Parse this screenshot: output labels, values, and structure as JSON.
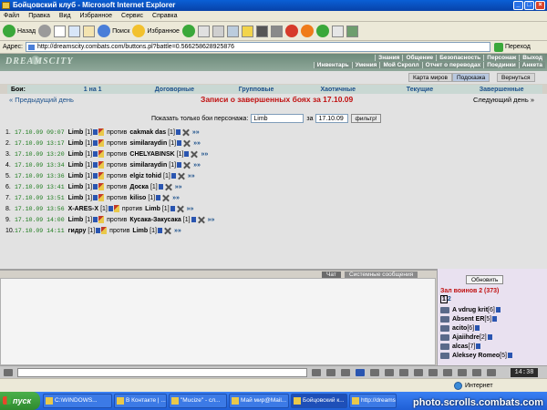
{
  "window": {
    "title": "Бойцовский клуб - Microsoft Internet Explorer"
  },
  "menu": [
    "Файл",
    "Правка",
    "Вид",
    "Избранное",
    "Сервис",
    "Справка"
  ],
  "toolbar": {
    "back": "Назад",
    "search": "Поиск",
    "favorites": "Избранное"
  },
  "address": {
    "label": "Адрес:",
    "url": "http://dreamscity.combats.com/buttons.pl?battle=0.566258628925876",
    "go": "Переход"
  },
  "site": {
    "logo": "DREAMSCITY",
    "nav_top": [
      "Знания",
      "Общение",
      "Безопасность",
      "Персонаж",
      "Выход"
    ],
    "nav_bottom": [
      "Инвентарь",
      "Умения",
      "Мой Скролл",
      "Отчет о переводах",
      "Поединки",
      "Анкета"
    ]
  },
  "tabs": [
    "Карта миров",
    "Подсказка",
    "Вернуться"
  ],
  "battle_types": {
    "label": "Бои:",
    "items": [
      "1 на 1",
      "Договорные",
      "Групповые",
      "Хаотичные",
      "Текущие",
      "Завершенные"
    ]
  },
  "records": {
    "prev_day": "« Предыдущий день",
    "title": "Записи о завершенных боях за 17.10.09",
    "next_day": "Следующий день »"
  },
  "filter": {
    "label": "Показать только бои персонажа:",
    "name": "Limb",
    "date_label": "за",
    "date": "17.10.09",
    "button": "фильтр!"
  },
  "battles": [
    {
      "num": "1.",
      "time": "17.10.09 09:07",
      "p1": "Limb",
      "p1lvl": "[1]",
      "vs": "против",
      "p2": "cakmak das",
      "p2lvl": "[1]",
      "more": "»»"
    },
    {
      "num": "2.",
      "time": "17.10.09 13:17",
      "p1": "Limb",
      "p1lvl": "[1]",
      "vs": "против",
      "p2": "similaraydin",
      "p2lvl": "[1]",
      "more": "»»"
    },
    {
      "num": "3.",
      "time": "17.10.09 13:20",
      "p1": "Limb",
      "p1lvl": "[1]",
      "vs": "против",
      "p2": "CHELYABINSK",
      "p2lvl": "[1]",
      "more": "»»"
    },
    {
      "num": "4.",
      "time": "17.10.09 13:34",
      "p1": "Limb",
      "p1lvl": "[1]",
      "vs": "против",
      "p2": "similaraydin",
      "p2lvl": "[1]",
      "more": "»»"
    },
    {
      "num": "5.",
      "time": "17.10.09 13:36",
      "p1": "Limb",
      "p1lvl": "[1]",
      "vs": "против",
      "p2": "elgiz tohid",
      "p2lvl": "[1]",
      "more": "»»"
    },
    {
      "num": "6.",
      "time": "17.10.09 13:41",
      "p1": "Limb",
      "p1lvl": "[1]",
      "vs": "против",
      "p2": "Доска",
      "p2lvl": "[1]",
      "more": "»»"
    },
    {
      "num": "7.",
      "time": "17.10.09 13:51",
      "p1": "Limb",
      "p1lvl": "[1]",
      "vs": "против",
      "p2": "kiliso",
      "p2lvl": "[1]",
      "more": "»»"
    },
    {
      "num": "8.",
      "time": "17.10.09 13:56",
      "p1": "X-ARES-X",
      "p1lvl": "[1]",
      "vs": "против",
      "p2": "Limb",
      "p2lvl": "[1]",
      "more": "»»"
    },
    {
      "num": "9.",
      "time": "17.10.09 14:00",
      "p1": "Limb",
      "p1lvl": "[1]",
      "vs": "против",
      "p2": "Кусака-Закусака",
      "p2lvl": "[1]",
      "more": "»»"
    },
    {
      "num": "10.",
      "time": "17.10.09 14:11",
      "p1": "гидру",
      "p1lvl": "[1]",
      "vs": "против",
      "p2": "Limb",
      "p2lvl": "[1]",
      "more": "»»"
    }
  ],
  "chat": {
    "tabs": [
      "Чат",
      "Системные сообщения"
    ]
  },
  "room": {
    "refresh": "Обновить",
    "title": "Зал воинов 2 (373)",
    "page_current": "1",
    "page_other": "2",
    "players": [
      {
        "name": "A vdrug krit",
        "lvl": "[6]"
      },
      {
        "name": "Absent ER",
        "lvl": "[5]"
      },
      {
        "name": "acito",
        "lvl": "[6]"
      },
      {
        "name": "Ajaiihdre",
        "lvl": "[2]"
      },
      {
        "name": "alcas",
        "lvl": "[7]"
      },
      {
        "name": "Aleksey Romeo",
        "lvl": "[5]"
      }
    ]
  },
  "clock": "14:38",
  "status": {
    "zone": "Интернет"
  },
  "taskbar": {
    "start": "пуск",
    "tasks": [
      "C:\\WINDOWS...",
      "В Контакте | ...",
      "\"Mucize\" - сл...",
      "Май мир@Mail...",
      "Бойцовский к...",
      "http://dreams..."
    ]
  },
  "watermark": "photo.scrolls.combats.com"
}
